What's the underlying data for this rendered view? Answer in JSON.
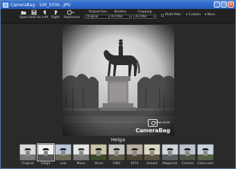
{
  "window": {
    "title": "CameraBag - 100_0330...JPG",
    "buttons": {
      "minimize": "_",
      "maximize": "□",
      "close": "x"
    }
  },
  "toolbar": {
    "tools": [
      {
        "name": "open",
        "label": "Open",
        "icon": "folder-icon"
      },
      {
        "name": "save-as",
        "label": "Save As",
        "icon": "save-icon"
      },
      {
        "name": "left",
        "label": "Left",
        "icon": "rotate-left-icon"
      },
      {
        "name": "right",
        "label": "Right",
        "icon": "rotate-right-icon"
      },
      {
        "name": "reprocess",
        "label": "Reprocess",
        "icon": "reprocess-icon"
      }
    ],
    "output_size": {
      "label": "Output Size",
      "value": "Original"
    },
    "borders": {
      "label": "Borders",
      "value": "As Filter"
    },
    "cropping": {
      "label": "Cropping",
      "value": "As Filter"
    },
    "multi_filter": {
      "label": "Multi-filter",
      "checked": false
    },
    "custom": {
      "label": "Custom"
    },
    "more": {
      "label": "More"
    }
  },
  "photo": {
    "watermark_tag": "TRIAL MODE",
    "watermark_name": "CameraBag"
  },
  "current_filter": "Helga",
  "filters": [
    "Original",
    "Helga",
    "Lolo",
    "Mono",
    "Silver",
    "1962",
    "1974",
    "Instant",
    "Magazine",
    "Cinema",
    "Colorcross"
  ],
  "colors": {
    "titlebar": "#2f6bcf",
    "background": "#2a2a2a"
  }
}
